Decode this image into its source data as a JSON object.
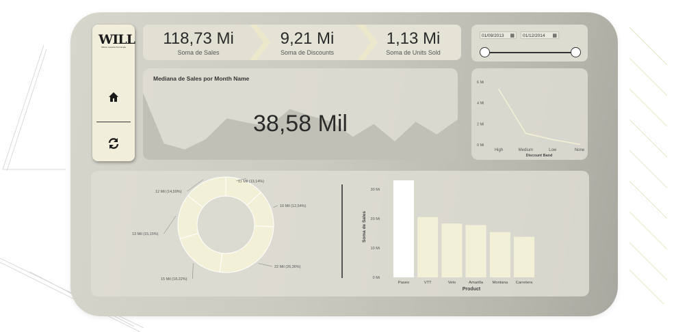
{
  "brand": {
    "logo_text": "WILL",
    "logo_subtitle": "Wilson Lacerda Tecnologia"
  },
  "sidebar": {
    "items": [
      {
        "icon": "home-icon"
      },
      {
        "icon": "refresh-icon"
      }
    ]
  },
  "kpis": [
    {
      "value": "118,73 Mi",
      "label": "Soma de  Sales"
    },
    {
      "value": "9,21 Mi",
      "label": "Soma de Discounts"
    },
    {
      "value": "1,13 Mi",
      "label": "Soma de Units Sold"
    }
  ],
  "date_filter": {
    "start": "01/09/2013",
    "end": "01/12/2014",
    "calendar_icon": "calendar-icon"
  },
  "area_card": {
    "title": "Mediana de Sales por Month Name",
    "value": "38,58 Mil"
  },
  "colors": {
    "accent": "#f3f0d8",
    "accent_dark": "#ebe7c6",
    "bar_highlight": "#ffffff",
    "card_bg": "#d7d6cc",
    "text": "#2a2a2a"
  },
  "chart_data": [
    {
      "type": "area",
      "title": "Mediana de Sales por Month Name",
      "values": [
        58,
        14,
        9,
        18,
        36,
        32,
        29,
        44,
        38,
        33,
        20,
        31,
        16,
        33,
        22,
        35
      ],
      "xlabel": "",
      "ylabel": "",
      "grid": false
    },
    {
      "type": "line",
      "categories": [
        "High",
        "Medium",
        "Low",
        "None"
      ],
      "values": [
        5.3,
        1.1,
        0.5,
        0.05
      ],
      "xlabel": "Discount Band",
      "ylabel": "",
      "y_ticks": [
        "0 Mi",
        "2 Mi",
        "4 Mi",
        "6 Mi"
      ],
      "ylim": [
        0,
        6
      ]
    },
    {
      "type": "pie",
      "style": "donut",
      "slices": [
        {
          "label": "11 Mil (13,14%)",
          "value": 13.14
        },
        {
          "label": "10 Mil (12,54%)",
          "value": 12.54
        },
        {
          "label": "22 Mil (26,36%)",
          "value": 26.36
        },
        {
          "label": "15 Mil (18,22%)",
          "value": 18.22
        },
        {
          "label": "13 Mil (15,15%)",
          "value": 15.15
        },
        {
          "label": "12 Mil (14,59%)",
          "value": 14.59
        }
      ]
    },
    {
      "type": "bar",
      "categories": [
        "Paseo",
        "VTT",
        "Velo",
        "Amarilla",
        "Montana",
        "Carretera"
      ],
      "values": [
        33,
        20.5,
        18.3,
        17.8,
        15.4,
        13.8
      ],
      "xlabel": "Product",
      "ylabel": "Soma de Sales",
      "y_ticks": [
        "0 Mi",
        "10 Mi",
        "20 Mi",
        "30 Mi"
      ],
      "ylim": [
        0,
        33
      ]
    }
  ]
}
